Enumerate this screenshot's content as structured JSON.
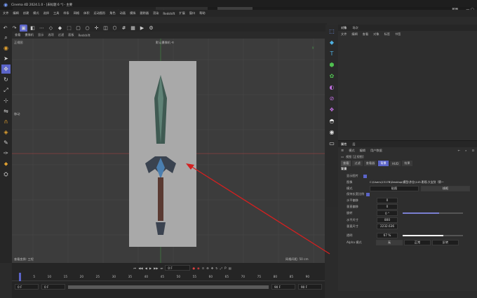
{
  "app": {
    "title": "Cinema 4D 2024.1.0 - [未标题 6 *] - 主要"
  },
  "doc_tabs": [
    "*未标题 4 *",
    "WF_Cellar.&...mtern1.obj",
    "未标题 4 *",
    "未标题 6 *"
  ],
  "layout_tabs": [
    "Standard",
    "Model",
    "Sculpt",
    "UVEdit",
    "Paint",
    "Groom",
    "Track",
    "Script",
    "Nodes"
  ],
  "new_layout": "新界面",
  "menu": [
    "文件",
    "编辑",
    "创建",
    "模式",
    "选择",
    "工具",
    "样条",
    "网格",
    "体积",
    "运动图形",
    "角色",
    "动画",
    "模拟",
    "跟踪器",
    "渲染",
    "Redshift",
    "扩展",
    "窗口",
    "帮助"
  ],
  "viewport": {
    "menu": [
      "查看",
      "摄像机",
      "显示",
      "选项",
      "过滤",
      "面板",
      "Redshift"
    ],
    "name": "正视图",
    "camera": "默认摄像机 ⟲",
    "mode": "移动",
    "axis": "y",
    "status_left": "查看变换: 工程",
    "status_right": "网格间距: 50 cm"
  },
  "object_panel": {
    "tabs": [
      "对象",
      "场次"
    ],
    "menu": [
      "文件",
      "编辑",
      "查看",
      "对象",
      "标签",
      "书签"
    ]
  },
  "attr_panel": {
    "tabs": [
      "属性",
      "层"
    ],
    "menu": [
      "模式",
      "编辑",
      "用户数据"
    ],
    "object": "视图 [正视图]",
    "subtabs": [
      "查看",
      "过滤",
      "查看器",
      "背景",
      "HUD",
      "效果"
    ],
    "active_subtab": "背景",
    "section": "背景",
    "show_image": "显示图片",
    "image_label": "图像",
    "image_path": "C:\\Users\\1317B\\Desktop\\模型\\作业\\143-影视-大宝剑（第一",
    "mode_label": "模式",
    "mode_opts": [
      "贴图",
      "线框"
    ],
    "keep_ratio": "保持长宽比例",
    "h_offset_label": "水平偏移",
    "h_offset": "0",
    "v_offset_label": "垂直偏移",
    "v_offset": "0",
    "rotate_label": "旋转",
    "rotate": "0 °",
    "h_size_label": "水平尺寸",
    "h_size": "800",
    "v_size_label": "垂直尺寸",
    "v_size": "2232.636",
    "transparency_label": "透明",
    "transparency": "67 %",
    "transparency_fraction": 0.67,
    "alpha_label": "Alpha 模式",
    "alpha_opts": [
      "无",
      "正常",
      "反转"
    ]
  },
  "timeline": {
    "frame": "0 F",
    "ticks": [
      "0",
      "5",
      "10",
      "15",
      "20",
      "25",
      "30",
      "35",
      "40",
      "45",
      "50",
      "55",
      "60",
      "65",
      "70",
      "75",
      "80",
      "85",
      "90"
    ],
    "start": "0 F",
    "start2": "0 F",
    "end": "90 F",
    "end2": "90 F"
  },
  "colors": {
    "accent": "#5b64c8",
    "annotation": "#d42020"
  }
}
